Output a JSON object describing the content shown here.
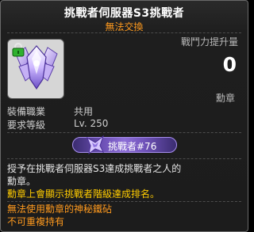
{
  "item": {
    "name": "挑戰者伺服器S3挑戰者",
    "trade_status": "無法交換",
    "power_label": "戰鬥力提升量",
    "power_value": "0",
    "category": "勳章"
  },
  "stats": [
    {
      "label": "裝備職業",
      "value": "共用"
    },
    {
      "label": "要求等級",
      "value": "Lv. 250"
    }
  ],
  "badge": {
    "text": "挑戰者#76"
  },
  "description": {
    "line1": "授予在挑戰者伺服器S3達成挑戰者之人的",
    "line2": "勳章。",
    "line3": "勳章上會顯示挑戰者階級達成排名。",
    "line4": "無法使用勳章的神秘鐵砧",
    "line5": "不可重複持有"
  },
  "colors": {
    "title": "#ffffff",
    "orange": "#ff9a1e",
    "yellow": "#ffcc00",
    "text": "#e6e6e6",
    "muted": "#b9b9b9"
  },
  "icons": {
    "item": "amethyst-wing-medal-icon",
    "lock": "green-lock-icon",
    "badge": "purple-wing-icon"
  }
}
